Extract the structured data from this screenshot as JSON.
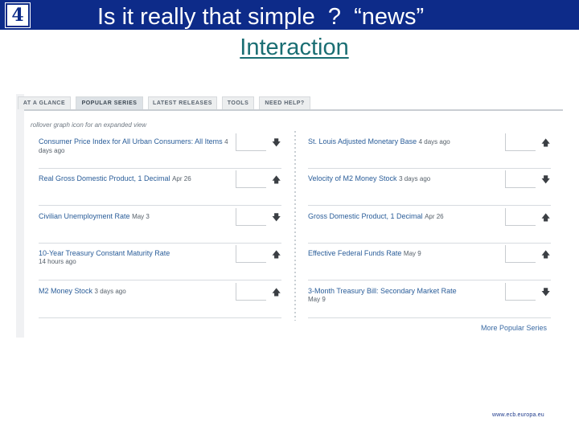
{
  "slide": {
    "number": "4",
    "title_line1": "Is it really that simple  ?  “news”",
    "title_line2": "Interaction",
    "footer_url": "www.ecb.europa.eu"
  },
  "colors": {
    "banner": "#0d2b89",
    "title_link": "#1a6e73",
    "series_link": "#2a5d99"
  },
  "widget": {
    "tabs": [
      {
        "label": "AT A GLANCE",
        "active": false
      },
      {
        "label": "POPULAR SERIES",
        "active": true
      },
      {
        "label": "LATEST RELEASES",
        "active": false
      },
      {
        "label": "TOOLS",
        "active": false
      },
      {
        "label": "NEED HELP?",
        "active": false
      }
    ],
    "hint": "rollover graph icon for an expanded view",
    "left_series": [
      {
        "name": "Consumer Price Index for All Urban Consumers: All Items",
        "ago": "4 days ago",
        "arrow": "down"
      },
      {
        "name": "Real Gross Domestic Product, 1 Decimal",
        "ago": "Apr 26",
        "arrow": "up"
      },
      {
        "name": "Civilian Unemployment Rate",
        "ago": "May 3",
        "arrow": "down"
      },
      {
        "name": "10-Year Treasury Constant Maturity Rate",
        "ago": "14 hours ago",
        "arrow": "up"
      },
      {
        "name": "M2 Money Stock",
        "ago": "3 days ago",
        "arrow": "up"
      }
    ],
    "right_series": [
      {
        "name": "St. Louis Adjusted Monetary Base",
        "ago": "4 days ago",
        "arrow": "up"
      },
      {
        "name": "Velocity of M2 Money Stock",
        "ago": "3 days ago",
        "arrow": "down"
      },
      {
        "name": "Gross Domestic Product, 1 Decimal",
        "ago": "Apr 26",
        "arrow": "up"
      },
      {
        "name": "Effective Federal Funds Rate",
        "ago": "May 9",
        "arrow": "up"
      },
      {
        "name": "3-Month Treasury Bill: Secondary Market Rate",
        "ago": "May 9",
        "arrow": "down"
      }
    ],
    "more_link": "More Popular Series"
  }
}
